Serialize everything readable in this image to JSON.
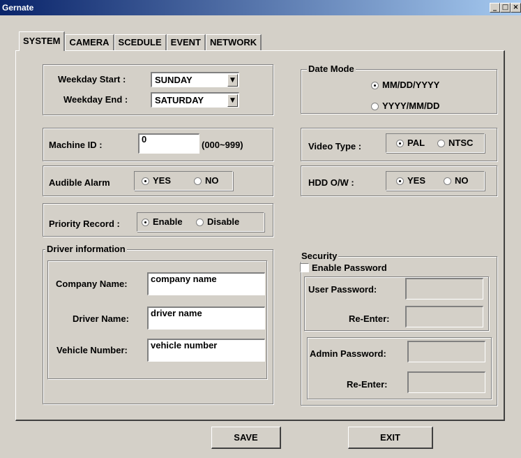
{
  "window": {
    "title": "Gernate",
    "min_glyph": "_",
    "max_glyph": "□",
    "close_glyph": "×"
  },
  "tabs": [
    "SYSTEM",
    "CAMERA",
    "SCEDULE",
    "EVENT",
    "NETWORK"
  ],
  "weekday": {
    "start_label": "Weekday Start :",
    "start_value": "SUNDAY",
    "end_label": "Weekday End :",
    "end_value": "SATURDAY",
    "dropdown_glyph": "▼"
  },
  "date_mode": {
    "legend": "Date Mode",
    "options": [
      "MM/DD/YYYY",
      "YYYY/MM/DD"
    ],
    "selected": 0
  },
  "machine_id": {
    "label": "Machine ID :",
    "value": "0",
    "range": "(000~999)"
  },
  "video_type": {
    "label": "Video Type :",
    "options": [
      "PAL",
      "NTSC"
    ],
    "selected": 0
  },
  "audible_alarm": {
    "label": "Audible Alarm",
    "options": [
      "YES",
      "NO"
    ],
    "selected": 0
  },
  "hdd_ow": {
    "label": "HDD O/W :",
    "options": [
      "YES",
      "NO"
    ],
    "selected": 0
  },
  "priority_record": {
    "label": "Priority Record :",
    "options": [
      "Enable",
      "Disable"
    ],
    "selected": 0
  },
  "driver_info": {
    "legend": "Driver information",
    "company_label": "Company Name:",
    "company_value": "company name",
    "driver_label": "Driver Name:",
    "driver_value": "driver name",
    "vehicle_label": "Vehicle Number:",
    "vehicle_value": "vehicle number"
  },
  "security": {
    "legend": "Security",
    "enable_label": "Enable Password",
    "enabled": false,
    "user_password_label": "User Password:",
    "user_reenter_label": "Re-Enter:",
    "admin_password_label": "Admin Password:",
    "admin_reenter_label": "Re-Enter:"
  },
  "buttons": {
    "save": "SAVE",
    "exit": "EXIT"
  }
}
